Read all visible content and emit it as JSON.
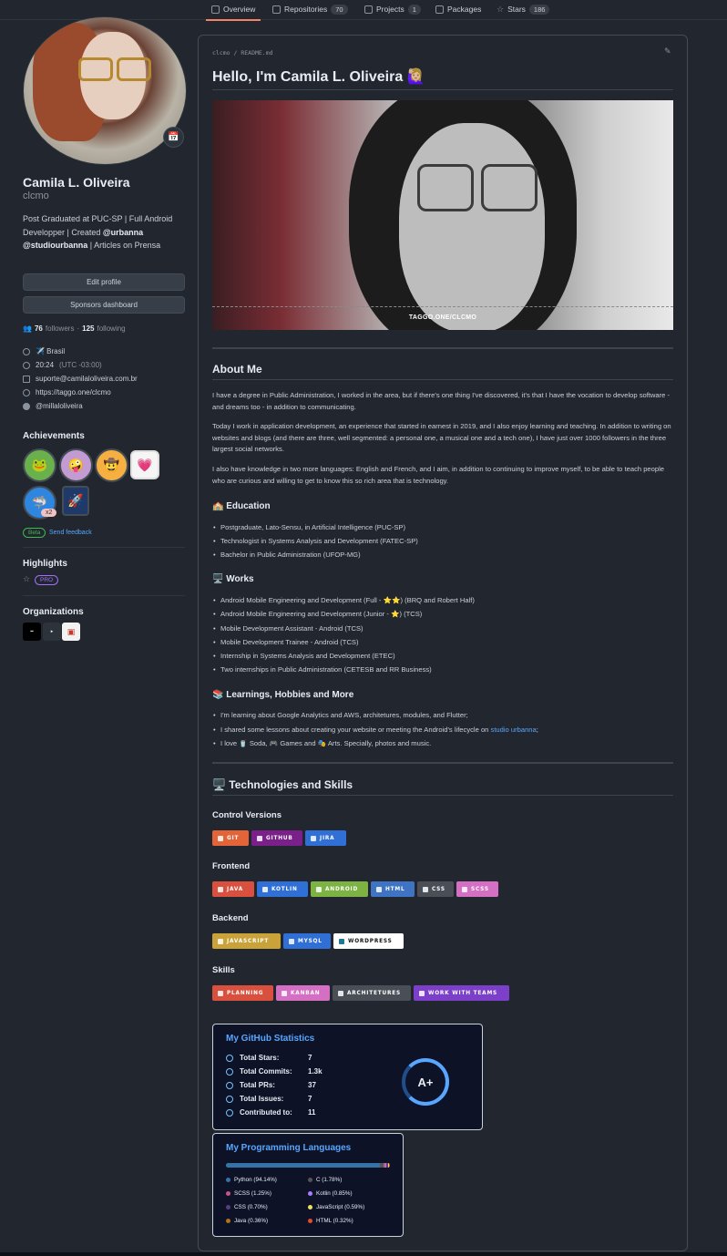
{
  "tabs": [
    {
      "label": "Overview",
      "count": ""
    },
    {
      "label": "Repositories",
      "count": "70"
    },
    {
      "label": "Projects",
      "count": "1"
    },
    {
      "label": "Packages",
      "count": ""
    },
    {
      "label": "Stars",
      "count": "186"
    }
  ],
  "profile": {
    "name": "Camila L. Oliveira",
    "login": "clcmo",
    "bio_1": "Post Graduated at PUC-SP | Full Android Developper | Created ",
    "bio_mention_1": "@urbanna",
    "bio_mention_2": "@studiourbanna",
    "bio_2": " | Articles on Prensa",
    "edit_profile": "Edit profile",
    "sponsors_dashboard": "Sponsors dashboard",
    "followers_count": "76",
    "followers_label": "followers",
    "following_count": "125",
    "following_label": "following",
    "location": "✈️ Brasil",
    "time": "20:24",
    "timezone": "(UTC -03:00)",
    "email": "suporte@camilaloliveira.com.br",
    "website": "https://taggo.one/clcmo",
    "twitter": "@millaloliveira"
  },
  "achievements": {
    "title": "Achievements",
    "multiplier": "x2",
    "beta_label": "Beta",
    "feedback_label": "Send feedback"
  },
  "highlights": {
    "title": "Highlights",
    "pro_label": "PRO"
  },
  "organizations": {
    "title": "Organizations"
  },
  "readme": {
    "path_user": "clcmo",
    "path_file": "README.md",
    "hello": "Hello, I'm Camila L. Oliveira 🙋🏼‍♀️",
    "banner_caption": "TAGGO.ONE/CLCMO",
    "about_title": "About Me",
    "about_p1": "I have a degree in Public Administration, I worked in the area, but if there's one thing I've discovered, it's that I have the vocation to develop software - and dreams too - in addition to communicating.",
    "about_p2": "Today I work in application development, an experience that started in earnest in 2019, and I also enjoy learning and teaching. In addition to writing on websites and blogs (and there are three, well segmented: a personal one, a musical one and a tech one), I have just over 1000 followers in the three largest social networks.",
    "about_p3": "I also have knowledge in two more languages: English and French, and I aim, in addition to continuing to improve myself, to be able to teach people who are curious and willing to get to know this so rich area that is technology.",
    "education_title": "🏫 Education",
    "education": [
      "Postgraduate, Lato-Sensu, in Artificial Intelligence (PUC-SP)",
      "Technologist in Systems Analysis and Development (FATEC-SP)",
      "Bachelor in Public Administration (UFOP-MG)"
    ],
    "works_title": "🖥️ Works",
    "works": [
      "Android Mobile Engineering and Development (Full - ⭐⭐) (BRQ and Robert Half)",
      "Android Mobile Engineering and Development (Junior - ⭐) (TCS)",
      "Mobile Development Assistant - Android (TCS)",
      "Mobile Development Trainee - Android (TCS)",
      "Internship in Systems Analysis and Development (ETEC)",
      "Two internships in Public Administration (CETESB and RR Business)"
    ],
    "learn_title": "📚 Learnings, Hobbies and More",
    "learn_1": "I'm learning about Google Analytics and AWS, architetures, modules, and Flutter;",
    "learn_2a": "I shared some lessons about creating your website or meeting the Android's lifecycle on ",
    "learn_2_link": "studio urbanna",
    "learn_2b": ";",
    "learn_3": "I love 🥤 Soda, 🎮 Games and 🎭 Arts. Specially, photos and music.",
    "tech_title": "🖥️ Technologies and Skills",
    "control_title": "Control Versions",
    "control": [
      {
        "label": "GIT",
        "color": "#e4643a"
      },
      {
        "label": "GITHUB",
        "color": "#7b1f8a"
      },
      {
        "label": "JIRA",
        "color": "#2f6fd6"
      }
    ],
    "frontend_title": "Frontend",
    "frontend": [
      {
        "label": "JAVA",
        "color": "#d9503f"
      },
      {
        "label": "KOTLIN",
        "color": "#2f6fd6"
      },
      {
        "label": "ANDROID",
        "color": "#7cb342"
      },
      {
        "label": "HTML",
        "color": "#3f74c4"
      },
      {
        "label": "CSS",
        "color": "#4a4f57"
      },
      {
        "label": "SCSS",
        "color": "#d46fc4"
      }
    ],
    "backend_title": "Backend",
    "backend": [
      {
        "label": "JAVASCRIPT",
        "color": "#c9a33a"
      },
      {
        "label": "MYSQL",
        "color": "#2f6fd6"
      },
      {
        "label": "WORDPRESS",
        "color": "#ffffff"
      }
    ],
    "skills_title": "Skills",
    "skills": [
      {
        "label": "PLANNING",
        "color": "#d9503f"
      },
      {
        "label": "KANBAN",
        "color": "#d46fc4"
      },
      {
        "label": "ARCHITETURES",
        "color": "#4a4f57"
      },
      {
        "label": "WORK WITH TEAMS",
        "color": "#7b3fc9"
      }
    ]
  },
  "stats": {
    "title": "My GitHub Statistics",
    "items": [
      {
        "label": "Total Stars:",
        "value": "7"
      },
      {
        "label": "Total Commits:",
        "value": "1.3k"
      },
      {
        "label": "Total PRs:",
        "value": "37"
      },
      {
        "label": "Total Issues:",
        "value": "7"
      },
      {
        "label": "Contributed to:",
        "value": "11"
      }
    ],
    "grade": "A+"
  },
  "languages": {
    "title": "My Programming Languages",
    "items": [
      {
        "label": "Python (94.14%)",
        "color": "#3572a5",
        "share": 94.14
      },
      {
        "label": "C (1.78%)",
        "color": "#555555",
        "share": 1.78
      },
      {
        "label": "SCSS (1.25%)",
        "color": "#c6538c",
        "share": 1.25
      },
      {
        "label": "Kotlin (0.85%)",
        "color": "#a97bff",
        "share": 0.85
      },
      {
        "label": "CSS (0.70%)",
        "color": "#563d7c",
        "share": 0.7
      },
      {
        "label": "JavaScript (0.59%)",
        "color": "#f1e05a",
        "share": 0.59
      },
      {
        "label": "Java (0.36%)",
        "color": "#b07219",
        "share": 0.36
      },
      {
        "label": "HTML (0.32%)",
        "color": "#e34c26",
        "share": 0.32
      }
    ]
  }
}
